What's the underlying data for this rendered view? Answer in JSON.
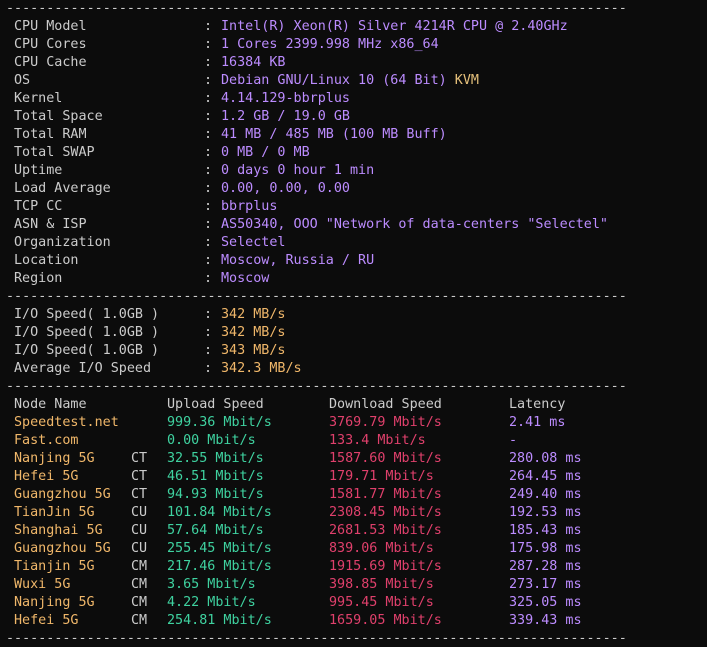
{
  "separator": "-----------------------------------------------------------------------------",
  "colors": {
    "label": "#cccccc",
    "system_value": "#bc8cff",
    "kvm": "#e5c07b",
    "io_value": "#f0b76a",
    "node_name": "#f0b76a",
    "upload": "#3fd2a0",
    "download": "#e0406c",
    "latency": "#bc8cff"
  },
  "system_info": [
    {
      "label": "CPU Model",
      "value": "Intel(R) Xeon(R) Silver 4214R CPU @ 2.40GHz"
    },
    {
      "label": "CPU Cores",
      "value": "1 Cores 2399.998 MHz x86_64"
    },
    {
      "label": "CPU Cache",
      "value": "16384 KB"
    },
    {
      "label": "OS",
      "value": "Debian GNU/Linux 10 (64 Bit)",
      "extra": "KVM"
    },
    {
      "label": "Kernel",
      "value": "4.14.129-bbrplus"
    },
    {
      "label": "Total Space",
      "value": "1.2 GB / 19.0 GB"
    },
    {
      "label": "Total RAM",
      "value": "41 MB / 485 MB (100 MB Buff)"
    },
    {
      "label": "Total SWAP",
      "value": "0 MB / 0 MB"
    },
    {
      "label": "Uptime",
      "value": "0 days 0 hour 1 min"
    },
    {
      "label": "Load Average",
      "value": "0.00, 0.00, 0.00"
    },
    {
      "label": "TCP CC",
      "value": "bbrplus"
    },
    {
      "label": "ASN & ISP",
      "value": "AS50340, OOO \"Network of data-centers \"Selectel\""
    },
    {
      "label": "Organization",
      "value": "Selectel"
    },
    {
      "label": "Location",
      "value": "Moscow, Russia / RU"
    },
    {
      "label": "Region",
      "value": "Moscow"
    }
  ],
  "colon": ":",
  "io_info": [
    {
      "label": "I/O Speed( 1.0GB )",
      "value": "342 MB/s"
    },
    {
      "label": "I/O Speed( 1.0GB )",
      "value": "342 MB/s"
    },
    {
      "label": "I/O Speed( 1.0GB )",
      "value": "343 MB/s"
    },
    {
      "label": "Average I/O Speed",
      "value": "342.3 MB/s"
    }
  ],
  "speed_table": {
    "headers": {
      "node": "Node Name",
      "upload": "Upload Speed",
      "download": "Download Speed",
      "latency": "Latency"
    },
    "rows": [
      {
        "node": "Speedtest.net",
        "isp": "",
        "upload": "999.36 Mbit/s",
        "download": "3769.79 Mbit/s",
        "latency": "2.41 ms"
      },
      {
        "node": "Fast.com",
        "isp": "",
        "upload": "0.00 Mbit/s",
        "download": "133.4 Mbit/s",
        "latency": "-"
      },
      {
        "node": "Nanjing 5G",
        "isp": "CT",
        "upload": "32.55 Mbit/s",
        "download": "1587.60 Mbit/s",
        "latency": "280.08 ms"
      },
      {
        "node": "Hefei 5G",
        "isp": "CT",
        "upload": "46.51 Mbit/s",
        "download": "179.71 Mbit/s",
        "latency": "264.45 ms"
      },
      {
        "node": "Guangzhou 5G",
        "isp": "CT",
        "upload": "94.93 Mbit/s",
        "download": "1581.77 Mbit/s",
        "latency": "249.40 ms"
      },
      {
        "node": "TianJin 5G",
        "isp": "CU",
        "upload": "101.84 Mbit/s",
        "download": "2308.45 Mbit/s",
        "latency": "192.53 ms"
      },
      {
        "node": "Shanghai 5G",
        "isp": "CU",
        "upload": "57.64 Mbit/s",
        "download": "2681.53 Mbit/s",
        "latency": "185.43 ms"
      },
      {
        "node": "Guangzhou 5G",
        "isp": "CU",
        "upload": "255.45 Mbit/s",
        "download": "839.06 Mbit/s",
        "latency": "175.98 ms"
      },
      {
        "node": "Tianjin 5G",
        "isp": "CM",
        "upload": "217.46 Mbit/s",
        "download": "1915.69 Mbit/s",
        "latency": "287.28 ms"
      },
      {
        "node": "Wuxi 5G",
        "isp": "CM",
        "upload": "3.65 Mbit/s",
        "download": "398.85 Mbit/s",
        "latency": "273.17 ms"
      },
      {
        "node": "Nanjing 5G",
        "isp": "CM",
        "upload": "4.22 Mbit/s",
        "download": "995.45 Mbit/s",
        "latency": "325.05 ms"
      },
      {
        "node": "Hefei 5G",
        "isp": "CM",
        "upload": "254.81 Mbit/s",
        "download": "1659.05 Mbit/s",
        "latency": "339.43 ms"
      }
    ]
  }
}
